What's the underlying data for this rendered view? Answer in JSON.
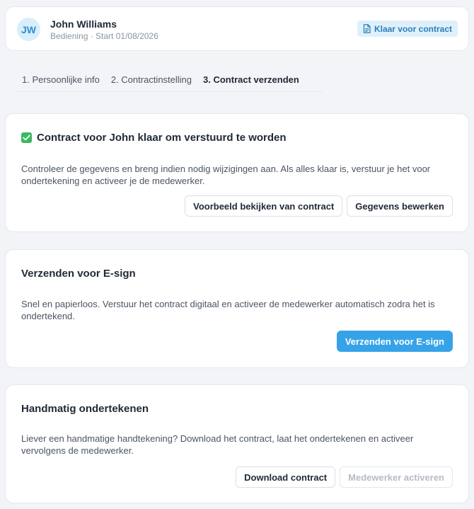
{
  "header": {
    "avatar_initials": "JW",
    "employee_name": "John Williams",
    "employee_meta": "Bediening · Start 01/08/2026",
    "status_badge": "Klaar voor contract"
  },
  "tabs": [
    {
      "label": "1. Persoonlijke info",
      "active": false
    },
    {
      "label": "2. Contractinstelling",
      "active": false
    },
    {
      "label": "3. Contract verzenden",
      "active": true
    }
  ],
  "ready_section": {
    "title": "Contract voor John klaar om verstuurd te worden",
    "description": "Controleer de gegevens en breng indien nodig wijzigingen aan. Als alles klaar is, verstuur je het voor ondertekening en activeer je de medewerker.",
    "preview_button": "Voorbeeld bekijken van contract",
    "edit_button": "Gegevens bewerken"
  },
  "esign_section": {
    "title": "Verzenden voor E-sign",
    "description": "Snel en papierloos. Verstuur het contract digitaal en activeer de medewerker automatisch zodra het is ondertekend.",
    "send_button": "Verzenden voor E-sign"
  },
  "manual_section": {
    "title": "Handmatig ondertekenen",
    "description": "Liever een handmatige handtekening? Download het contract, laat het ondertekenen en activeer vervolgens de medewerker.",
    "download_button": "Download contract",
    "activate_button": "Medewerker activeren"
  },
  "icons": {
    "status_badge_icon": "document-icon",
    "ready_title_icon": "check-square-icon"
  },
  "colors": {
    "accent": "#36a3e8",
    "badge_bg": "#dff0fb",
    "badge_text": "#2b7fba",
    "success": "#3cb95e",
    "page_bg": "#f2f4f7"
  }
}
